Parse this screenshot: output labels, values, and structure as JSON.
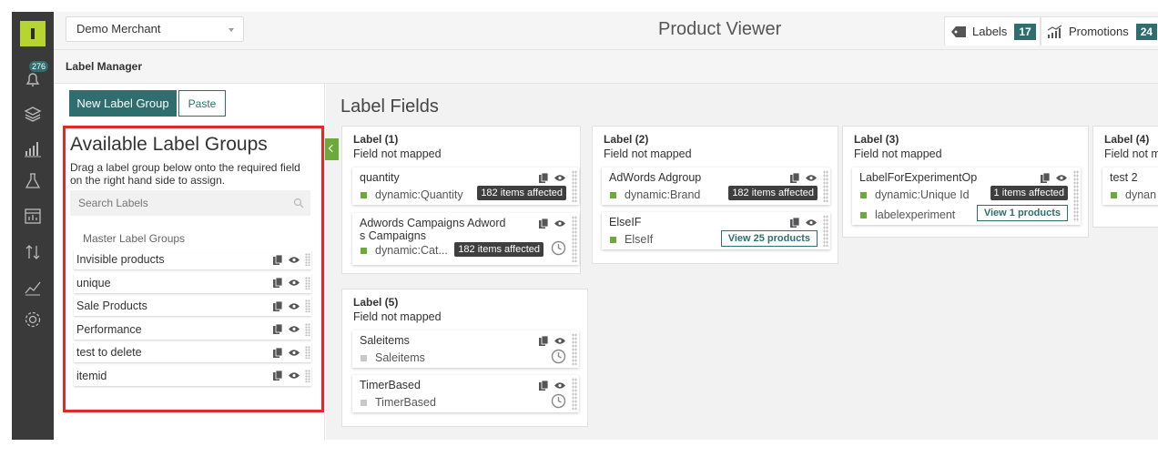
{
  "rail": {
    "notification_count": "276"
  },
  "header": {
    "merchant": "Demo Merchant",
    "title": "Product Viewer",
    "tabs": [
      {
        "label": "Labels",
        "count": "17"
      },
      {
        "label": "Promotions",
        "count": "24"
      }
    ]
  },
  "section_title": "Label Manager",
  "left": {
    "new_button": "New Label Group",
    "paste_button": "Paste",
    "title": "Available Label Groups",
    "description": "Drag a label group below onto the required field on the right hand side to assign.",
    "search_placeholder": "Search Labels",
    "group_header": "Master Label Groups",
    "groups": [
      "Invisible products",
      "unique",
      "Sale Products",
      "Performance",
      "test to delete",
      "itemid"
    ]
  },
  "right": {
    "title": "Label Fields",
    "cards": [
      {
        "header": "Label (1)",
        "subtitle": "Field not mapped",
        "items": [
          {
            "name": "quantity",
            "source": "dynamic:Quantity",
            "affected": "182 items affected"
          },
          {
            "name_line1": "Adwords Campaigns Adword",
            "name_line2": "s Campaigns",
            "source": "dynamic:Cat...",
            "affected": "182 items affected"
          }
        ]
      },
      {
        "header": "Label (2)",
        "subtitle": "Field not mapped",
        "items": [
          {
            "name": "AdWords Adgroup",
            "source": "dynamic:Brand",
            "affected": "182 items affected"
          },
          {
            "name": "ElseIF",
            "source": "ElseIf",
            "button": "View 25 products"
          }
        ]
      },
      {
        "header": "Label (3)",
        "subtitle": "Field not mapped",
        "items": [
          {
            "name": "LabelForExperimentOp",
            "source": "dynamic:Unique Id",
            "affected": "1 items affected",
            "source2": "labelexperiment",
            "button": "View 1 products"
          }
        ]
      },
      {
        "header": "Label (4)",
        "subtitle": "Field not m",
        "items": [
          {
            "name": "test 2",
            "source": "dynan"
          }
        ]
      },
      {
        "header": "Label (5)",
        "subtitle": "Field not mapped",
        "items": [
          {
            "name": "Saleitems",
            "source": "Saleitems"
          },
          {
            "name": "TimerBased",
            "source": "TimerBased"
          }
        ]
      }
    ]
  },
  "colors": {
    "brand": "#b7d431",
    "accent": "#2e6e6e",
    "highlight_border": "#e02a2a",
    "status_green": "#6ea93b"
  }
}
